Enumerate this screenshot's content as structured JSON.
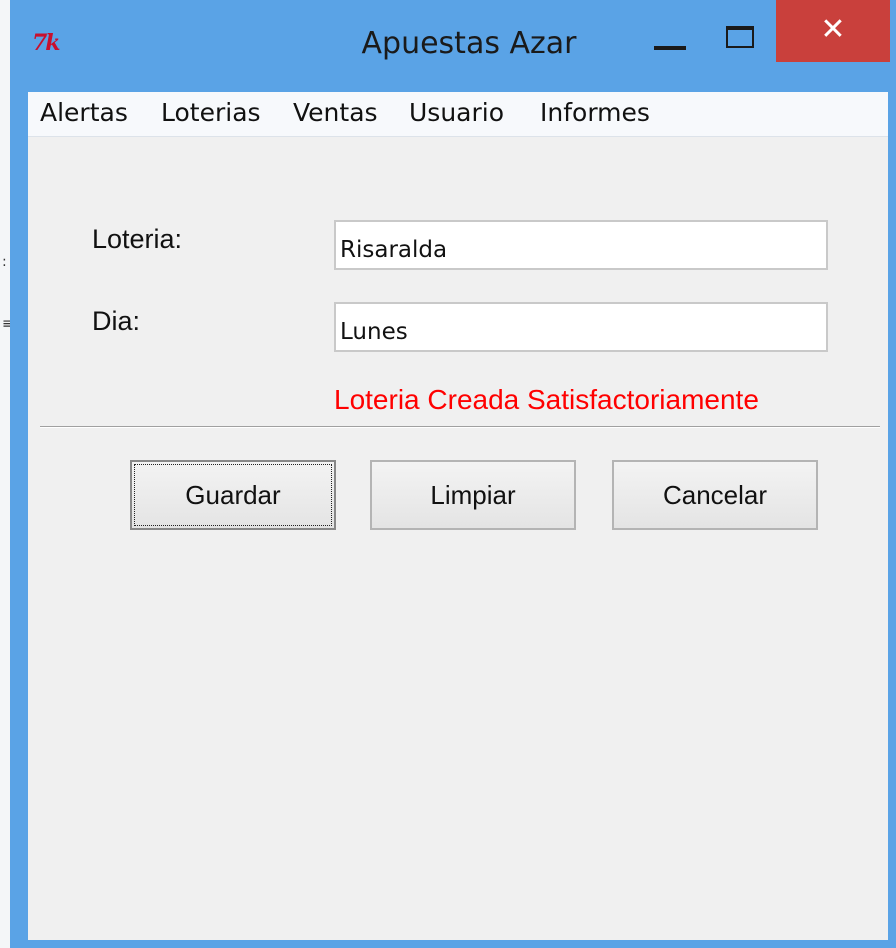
{
  "window": {
    "title": "Apuestas Azar",
    "icon": "tk-feather-icon",
    "icon_text": "7k",
    "controls": {
      "minimize": "minimize-icon",
      "maximize": "maximize-icon",
      "close": "close-icon",
      "close_glyph": "✕"
    }
  },
  "menu": {
    "items": [
      {
        "label": "Alertas"
      },
      {
        "label": "Loterias"
      },
      {
        "label": "Ventas"
      },
      {
        "label": "Usuario"
      },
      {
        "label": "Informes"
      }
    ]
  },
  "form": {
    "loteria_label": "Loteria:",
    "loteria_value": "Risaralda",
    "dia_label": "Dia:",
    "dia_value": "Lunes",
    "status_message": "Loteria Creada Satisfactoriamente",
    "status_color": "#ff0000"
  },
  "buttons": {
    "guardar": "Guardar",
    "limpiar": "Limpiar",
    "cancelar": "Cancelar"
  },
  "colors": {
    "title_bar": "#5aa3e6",
    "close_button": "#c9403c",
    "client_background": "#f0f0f0"
  }
}
